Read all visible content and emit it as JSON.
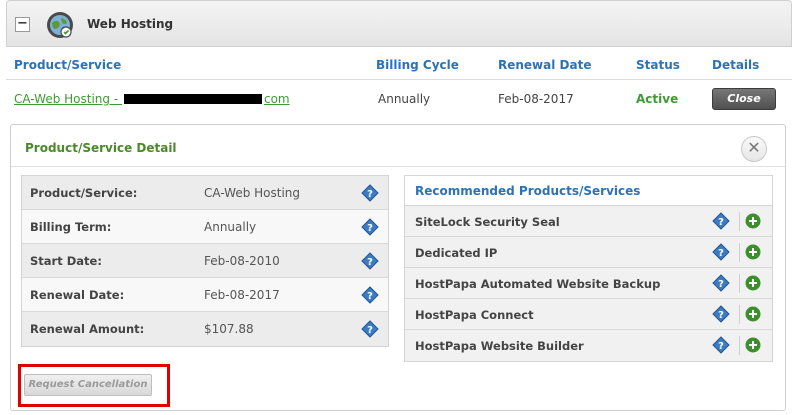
{
  "header": {
    "title": "Web Hosting",
    "collapse_symbol": "−",
    "icon": "web-hosting-globe-icon"
  },
  "columns": {
    "product": "Product/Service",
    "billing_cycle": "Billing Cycle",
    "renewal_date": "Renewal Date",
    "status": "Status",
    "details": "Details"
  },
  "product_row": {
    "name_prefix": "CA-Web Hosting - ",
    "name_suffix": "com",
    "billing_cycle": "Annually",
    "renewal_date": "Feb-08-2017",
    "status": "Active",
    "close_label": "Close"
  },
  "detail": {
    "title": "Product/Service Detail",
    "close_symbol": "✕",
    "info": [
      {
        "label": "Product/Service:",
        "value": "CA-Web Hosting"
      },
      {
        "label": "Billing Term:",
        "value": "Annually"
      },
      {
        "label": "Start Date:",
        "value": "Feb-08-2010"
      },
      {
        "label": "Renewal Date:",
        "value": "Feb-08-2017"
      },
      {
        "label": "Renewal Amount:",
        "value": "$107.88"
      }
    ],
    "recommended": {
      "title": "Recommended Products/Services",
      "items": [
        "SiteLock Security Seal",
        "Dedicated IP",
        "HostPapa Automated Website Backup",
        "HostPapa Connect",
        "HostPapa Website Builder"
      ]
    },
    "request_cancellation_label": "Request Cancellation"
  },
  "colors": {
    "link_blue": "#2b73b8",
    "active_green": "#3d9b35",
    "highlight_red": "#e00000",
    "help_icon_blue": "#3b7cc4"
  }
}
